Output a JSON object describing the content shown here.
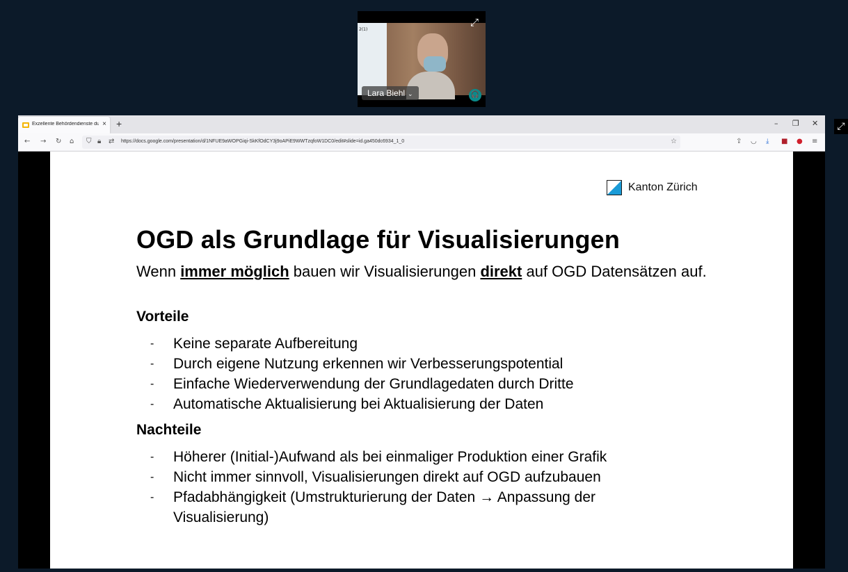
{
  "video": {
    "participant_name": "Lara Biehl",
    "board_text": "2(1)",
    "expand_icon": "expand-icon",
    "audio_icon": "headphones-icon"
  },
  "browser": {
    "tab_title": "Exzellente Behördendienste du",
    "tab_close": "×",
    "new_tab": "+",
    "url": "https://docs.google.com/presentation/d/1NFUE9aWOPGiqi-SkKfOdCY3j9oAPiE9WWTzqfoW1DC0/edit#slide=id.ga450dc6934_1_0"
  },
  "slide": {
    "logo_text": "Kanton Zürich",
    "title": "OGD als Grundlage für Visualisierungen",
    "intro": {
      "part1": "Wenn ",
      "emph1": "immer möglich",
      "part2": " bauen wir Visualisierungen ",
      "emph2": "direkt",
      "part3": " auf OGD Datensätzen auf."
    },
    "pros_heading": "Vorteile",
    "pros": [
      "Keine separate Aufbereitung",
      "Durch eigene Nutzung erkennen wir Verbesserungspotential",
      "Einfache Wiederverwendung der Grundlagedaten durch Dritte",
      "Automatische Aktualisierung bei Aktualisierung der Daten"
    ],
    "cons_heading": "Nachteile",
    "cons": [
      "Höherer (Initial-)Aufwand als bei einmaliger Produktion einer Grafik",
      "Nicht immer sinnvoll, Visualisierungen direkt auf OGD aufzubauen",
      "Pfadabhängigkeit (Umstrukturierung der Daten →  Anpassung der Visualisierung)"
    ],
    "bullet_marker": "-"
  },
  "colors": {
    "background": "#0c1a29",
    "logo_accent": "#1a9bd7",
    "audio_badge": "#0b8a8a"
  }
}
